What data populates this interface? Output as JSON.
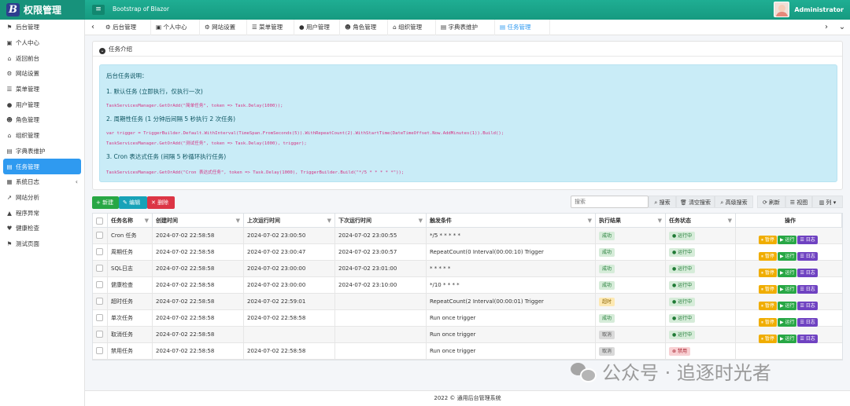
{
  "brand": {
    "logo": "B",
    "title": "权限管理"
  },
  "header": {
    "app_name": "Bootstrap of Blazor",
    "user_name": "Administrator"
  },
  "sidebar": {
    "items": [
      {
        "label": "后台管理",
        "icon": "flag-icon"
      },
      {
        "label": "个人中心",
        "icon": "id-card-icon"
      },
      {
        "label": "返回前台",
        "icon": "home-icon"
      },
      {
        "label": "网站设置",
        "icon": "gear-icon"
      },
      {
        "label": "菜单管理",
        "icon": "bars-icon"
      },
      {
        "label": "用户管理",
        "icon": "user-icon"
      },
      {
        "label": "角色管理",
        "icon": "users-icon"
      },
      {
        "label": "组织管理",
        "icon": "building-icon"
      },
      {
        "label": "字典表维护",
        "icon": "book-icon"
      },
      {
        "label": "任务管理",
        "icon": "tasks-icon",
        "active": true
      },
      {
        "label": "系统日志",
        "icon": "log-icon",
        "has_children": true
      },
      {
        "label": "网站分析",
        "icon": "chart-icon"
      },
      {
        "label": "程序异常",
        "icon": "warning-icon"
      },
      {
        "label": "健康检查",
        "icon": "heartbeat-icon"
      },
      {
        "label": "测试页面",
        "icon": "flag-icon"
      }
    ]
  },
  "tabs": [
    {
      "label": "后台管理"
    },
    {
      "label": "个人中心"
    },
    {
      "label": "网站设置"
    },
    {
      "label": "菜单管理"
    },
    {
      "label": "用户管理"
    },
    {
      "label": "角色管理"
    },
    {
      "label": "组织管理"
    },
    {
      "label": "字典表维护"
    },
    {
      "label": "任务管理",
      "active": true
    }
  ],
  "intro": {
    "title": "任务介绍",
    "heading": "后台任务说明：",
    "item1": "1. 默认任务 (立即执行，仅执行一次)",
    "code1": "TaskServicesManager.GetOrAdd(\"简单任务\", token => Task.Delay(1000));",
    "item2": "2. 周期性任务 (1 分钟后间隔 5 秒执行 2 次任务)",
    "code2a": "var trigger = TriggerBuilder.Default.WithInterval(TimeSpan.FromSeconds(5)).WithRepeatCount(2).WithStartTime(DateTimeOffset.Now.AddMinutes(1)).Build();",
    "code2b": "TaskServicesManager.GetOrAdd(\"测试任务\", token => Task.Delay(1000), trigger);",
    "item3": "3. Cron 表达式任务 (间隔 5 秒循环执行任务)",
    "code3": "TaskServicesManager.GetOrAdd(\"Cron 表达式任务\", token => Task.Delay(1000), TriggerBuilder.Build(\"*/5 * * * * *\"));"
  },
  "toolbar": {
    "new": "+ 新建",
    "edit": "✎ 编辑",
    "delete": "✕ 删除",
    "search_placeholder": "搜索",
    "search_btn": "搜索",
    "clear_btn": "清空搜索",
    "advanced_btn": "高级搜索",
    "refresh_btn": "刷新",
    "view_btn": "视图",
    "columns_btn": "列"
  },
  "table": {
    "headers": [
      "任务名称",
      "创建时间",
      "上次运行时间",
      "下次运行时间",
      "触发条件",
      "执行结果",
      "任务状态",
      "操作"
    ],
    "rows": [
      {
        "name": "Cron 任务",
        "created": "2024-07-02 22:58:58",
        "last": "2024-07-02 23:00:50",
        "next": "2024-07-02 23:00:55",
        "trigger": "*/5 * * * * *",
        "result": "成功",
        "result_type": "ok",
        "status": "运行中",
        "status_type": "run",
        "ops": [
          "暂停",
          "运行",
          "日志"
        ]
      },
      {
        "name": "周期任务",
        "created": "2024-07-02 22:58:58",
        "last": "2024-07-02 23:00:47",
        "next": "2024-07-02 23:00:57",
        "trigger": "RepeatCount(0 Interval(00:00:10) Trigger",
        "result": "成功",
        "result_type": "ok",
        "status": "运行中",
        "status_type": "run",
        "ops": [
          "暂停",
          "运行",
          "日志"
        ]
      },
      {
        "name": "SQL日志",
        "created": "2024-07-02 22:58:58",
        "last": "2024-07-02 23:00:00",
        "next": "2024-07-02 23:01:00",
        "trigger": "* * * * *",
        "result": "成功",
        "result_type": "ok",
        "status": "运行中",
        "status_type": "run",
        "ops": [
          "暂停",
          "运行",
          "日志"
        ]
      },
      {
        "name": "健康检查",
        "created": "2024-07-02 22:58:58",
        "last": "2024-07-02 23:00:00",
        "next": "2024-07-02 23:10:00",
        "trigger": "*/10 * * * *",
        "result": "成功",
        "result_type": "ok",
        "status": "运行中",
        "status_type": "run",
        "ops": [
          "暂停",
          "运行",
          "日志"
        ]
      },
      {
        "name": "超时任务",
        "created": "2024-07-02 22:58:58",
        "last": "2024-07-02 22:59:01",
        "next": "",
        "trigger": "RepeatCount(2 Interval(00:00:01) Trigger",
        "result": "超时",
        "result_type": "to",
        "status": "运行中",
        "status_type": "run",
        "ops": [
          "暂停",
          "运行",
          "日志"
        ]
      },
      {
        "name": "单次任务",
        "created": "2024-07-02 22:58:58",
        "last": "2024-07-02 22:58:58",
        "next": "",
        "trigger": "Run once trigger",
        "result": "成功",
        "result_type": "ok",
        "status": "运行中",
        "status_type": "run",
        "ops": [
          "暂停",
          "运行",
          "日志"
        ]
      },
      {
        "name": "取消任务",
        "created": "2024-07-02 22:58:58",
        "last": "",
        "next": "",
        "trigger": "Run once trigger",
        "result": "取消",
        "result_type": "cancel",
        "status": "运行中",
        "status_type": "run",
        "ops": [
          "暂停",
          "运行",
          "日志"
        ]
      },
      {
        "name": "禁用任务",
        "created": "2024-07-02 22:58:58",
        "last": "2024-07-02 22:58:58",
        "next": "",
        "trigger": "Run once trigger",
        "result": "取消",
        "result_type": "cancel",
        "status": "禁用",
        "status_type": "dis",
        "ops": []
      }
    ]
  },
  "footer": "2022 © 通用后台管理系统",
  "watermark": "公众号 · 追逐时光者"
}
